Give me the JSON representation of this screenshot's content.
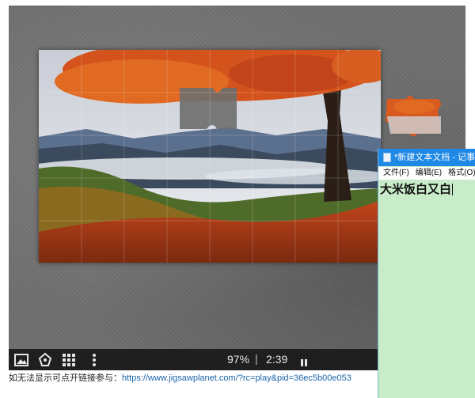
{
  "board": {
    "progress": "97%",
    "separator": "|",
    "timer": "2:39"
  },
  "controls": [
    {
      "name": "image-preview-icon"
    },
    {
      "name": "ghost-image-icon"
    },
    {
      "name": "scatter-pieces-icon"
    },
    {
      "name": "more-options-icon"
    }
  ],
  "caption": {
    "prefix": "如无法显示可点开链接参与：",
    "link": "https://www.jigsawplanet.com/?rc=play&pid=36ec5b00e053"
  },
  "notepad": {
    "title": "*新建文本文档 - 记事本",
    "menu": [
      "文件(F)",
      "编辑(E)",
      "格式(O)"
    ],
    "content": "大米饭白又白"
  },
  "colors": {
    "board": "#6e6e6e",
    "control_bar": "#1f1f1f",
    "notepad_title": "#1e88e5",
    "notepad_bg": "#c8ebc8",
    "link": "#1a64a8"
  }
}
